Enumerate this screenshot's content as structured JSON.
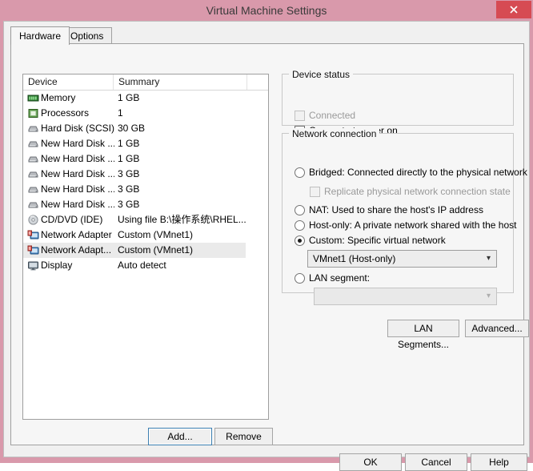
{
  "window": {
    "title": "Virtual Machine Settings",
    "close_label": "close-icon",
    "titlebar_color": "#d999ab",
    "close_color": "#d64b53"
  },
  "tabs": [
    {
      "label": "Hardware",
      "active": true
    },
    {
      "label": "Options",
      "active": false
    }
  ],
  "device_list": {
    "columns": [
      "Device",
      "Summary"
    ],
    "rows": [
      {
        "icon": "memory-icon",
        "name": "Memory",
        "summary": "1 GB",
        "selected": false
      },
      {
        "icon": "processor-icon",
        "name": "Processors",
        "summary": "1",
        "selected": false
      },
      {
        "icon": "harddisk-icon",
        "name": "Hard Disk (SCSI)",
        "summary": "30 GB",
        "selected": false
      },
      {
        "icon": "harddisk-icon",
        "name": "New Hard Disk ...",
        "summary": "1 GB",
        "selected": false
      },
      {
        "icon": "harddisk-icon",
        "name": "New Hard Disk ...",
        "summary": "1 GB",
        "selected": false
      },
      {
        "icon": "harddisk-icon",
        "name": "New Hard Disk ...",
        "summary": "3 GB",
        "selected": false
      },
      {
        "icon": "harddisk-icon",
        "name": "New Hard Disk ...",
        "summary": "3 GB",
        "selected": false
      },
      {
        "icon": "harddisk-icon",
        "name": "New Hard Disk ...",
        "summary": "3 GB",
        "selected": false
      },
      {
        "icon": "cddvd-icon",
        "name": "CD/DVD (IDE)",
        "summary": "Using file B:\\操作系统\\RHEL...",
        "selected": false
      },
      {
        "icon": "network-adapter-icon",
        "name": "Network Adapter",
        "summary": "Custom (VMnet1)",
        "selected": false
      },
      {
        "icon": "network-adapter-icon",
        "name": "Network Adapt...",
        "summary": "Custom (VMnet1)",
        "selected": true
      },
      {
        "icon": "display-icon",
        "name": "Display",
        "summary": "Auto detect",
        "selected": false
      }
    ],
    "add_label": "Add...",
    "remove_label": "Remove"
  },
  "device_status": {
    "group_label": "Device status",
    "connected": {
      "label": "Connected",
      "checked": false,
      "disabled": true
    },
    "connect_at_power_on": {
      "label": "Connect at power on",
      "checked": true,
      "disabled": false
    }
  },
  "network_connection": {
    "group_label": "Network connection",
    "options": [
      {
        "label": "Bridged: Connected directly to the physical network",
        "selected": false
      },
      {
        "label": "NAT: Used to share the host's IP address",
        "selected": false
      },
      {
        "label": "Host-only: A private network shared with the host",
        "selected": false
      },
      {
        "label": "Custom: Specific virtual network",
        "selected": true
      },
      {
        "label": "LAN segment:",
        "selected": false
      }
    ],
    "replicate_checkbox": {
      "label": "Replicate physical network connection state",
      "checked": false,
      "disabled": true
    },
    "vmnet_select": {
      "value": "VMnet1 (Host-only)",
      "disabled": false,
      "arrow": "chevron-down-icon"
    },
    "lan_select": {
      "value": "",
      "disabled": true,
      "arrow": "chevron-down-icon"
    },
    "lan_segments_button": "LAN Segments...",
    "advanced_button": "Advanced..."
  },
  "dialog_buttons": {
    "ok": "OK",
    "cancel": "Cancel",
    "help": "Help"
  }
}
